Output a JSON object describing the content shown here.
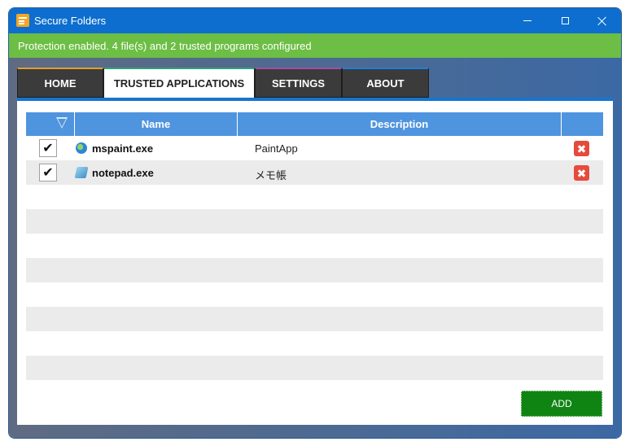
{
  "window": {
    "title": "Secure Folders",
    "icon": "secure-folders-app-icon"
  },
  "status": {
    "message": "Protection enabled. 4 file(s) and 2 trusted programs configured",
    "color": "#6cbe44"
  },
  "tabs": [
    {
      "label": "HOME",
      "accent": "#e0a030"
    },
    {
      "label": "TRUSTED APPLICATIONS",
      "accent": "#2fa37a",
      "selected": true
    },
    {
      "label": "SETTINGS",
      "accent": "#a64ca6"
    },
    {
      "label": "ABOUT",
      "accent": "#1e7fd6"
    }
  ],
  "grid": {
    "columns": {
      "name": "Name",
      "description": "Description"
    },
    "rows": [
      {
        "checked": true,
        "icon": "paint-app-icon",
        "name": "mspaint.exe",
        "description": "PaintApp"
      },
      {
        "checked": true,
        "icon": "notepad-app-icon",
        "name": "notepad.exe",
        "description": "メモ帳"
      }
    ],
    "check_glyph": "✔",
    "delete_glyph": "✖"
  },
  "actions": {
    "add_label": "ADD"
  },
  "colors": {
    "titlebar": "#0d6ecf",
    "header": "#4f94de",
    "add_button": "#0f8413",
    "delete": "#e54b3c"
  }
}
